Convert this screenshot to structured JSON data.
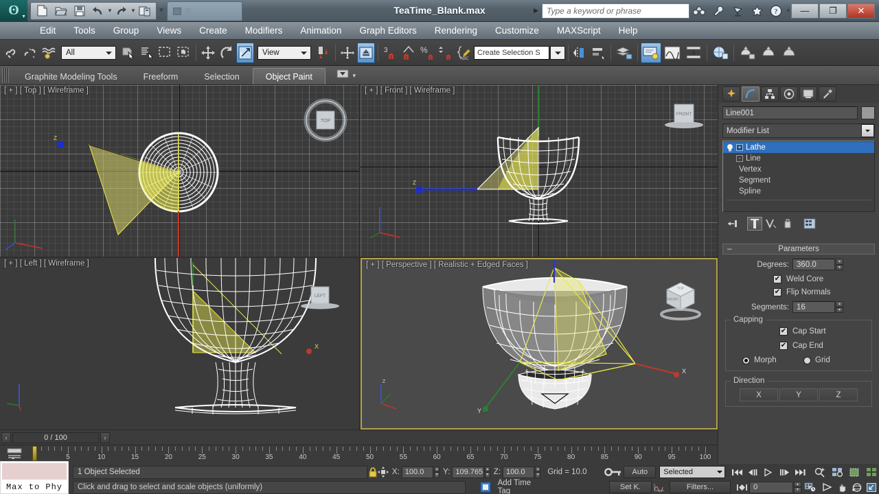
{
  "app": {
    "title": "TeaTime_Blank.max",
    "search_placeholder": "Type a keyword or phrase",
    "logo_glyph": "ʘ"
  },
  "quick_access": [
    {
      "name": "new-file",
      "label": "New"
    },
    {
      "name": "open-file",
      "label": "Open"
    },
    {
      "name": "save-file",
      "label": "Save"
    },
    {
      "name": "undo",
      "label": "Undo"
    },
    {
      "name": "redo",
      "label": "Redo"
    },
    {
      "name": "project-folder",
      "label": "Set Project Folder"
    }
  ],
  "window_buttons": {
    "minimize": "—",
    "maximize": "❐",
    "close": "✕"
  },
  "title_icons": [
    {
      "name": "binoculars-icon",
      "label": "Search"
    },
    {
      "name": "wrench-icon",
      "label": "Tools"
    },
    {
      "name": "satellite-icon",
      "label": "Communication Center"
    },
    {
      "name": "star-icon",
      "label": "Favorites"
    },
    {
      "name": "help-icon",
      "label": "Help"
    }
  ],
  "menu": {
    "items": [
      "Edit",
      "Tools",
      "Group",
      "Views",
      "Create",
      "Modifiers",
      "Animation",
      "Graph Editors",
      "Rendering",
      "Customize",
      "MAXScript",
      "Help"
    ]
  },
  "toolbar": {
    "selection_filter": "All",
    "reference_coord": "View",
    "named_selection_sets": "Create Selection S",
    "snap_count": "3",
    "buttons": [
      {
        "name": "select-and-link-icon",
        "label": "Select and Link"
      },
      {
        "name": "unlink-selection-icon",
        "label": "Unlink Selection"
      },
      {
        "name": "bind-to-space-warp-icon",
        "label": "Bind to Space Warp"
      },
      {
        "name": "select-object-icon",
        "label": "Select Object"
      },
      {
        "name": "select-by-name-icon",
        "label": "Select by Name"
      },
      {
        "name": "rectangular-selection-region-icon",
        "label": "Rectangular Selection Region"
      },
      {
        "name": "window-crossing-icon",
        "label": "Window / Crossing"
      },
      {
        "name": "select-and-move-icon",
        "label": "Select and Move"
      },
      {
        "name": "select-and-rotate-icon",
        "label": "Select and Rotate"
      },
      {
        "name": "select-and-scale-icon",
        "label": "Select and Uniform Scale"
      },
      {
        "name": "use-pivot-point-center-icon",
        "label": "Use Pivot Point Center"
      },
      {
        "name": "select-and-manipulate-icon",
        "label": "Select and Manipulate"
      },
      {
        "name": "snaps-toggle-icon",
        "label": "Snaps Toggle"
      },
      {
        "name": "angle-snap-toggle-icon",
        "label": "Angle Snap Toggle"
      },
      {
        "name": "percent-snap-toggle-icon",
        "label": "Percent Snap Toggle"
      },
      {
        "name": "spinner-snap-toggle-icon",
        "label": "Spinner Snap Toggle"
      },
      {
        "name": "edit-named-selection-sets-icon",
        "label": "Edit Named Selection Sets"
      },
      {
        "name": "mirror-icon",
        "label": "Mirror"
      },
      {
        "name": "align-icon",
        "label": "Align"
      },
      {
        "name": "layer-manager-icon",
        "label": "Layer Explorer"
      },
      {
        "name": "toggle-scene-explorer-icon",
        "label": "Toggle Scene Explorer"
      },
      {
        "name": "curve-editor-icon",
        "label": "Curve Editor"
      },
      {
        "name": "schematic-view-icon",
        "label": "Schematic View"
      },
      {
        "name": "material-editor-icon",
        "label": "Material Editor"
      },
      {
        "name": "render-setup-icon",
        "label": "Render Setup"
      },
      {
        "name": "rendered-frame-window-icon",
        "label": "Rendered Frame Window"
      },
      {
        "name": "render-production-icon",
        "label": "Render Production"
      }
    ]
  },
  "ribbon": {
    "tabs": [
      {
        "label": "Graphite Modeling Tools",
        "active": false
      },
      {
        "label": "Freeform",
        "active": false
      },
      {
        "label": "Selection",
        "active": false
      },
      {
        "label": "Object Paint",
        "active": true
      }
    ],
    "overflow_icon": "polygon-modeling-icon"
  },
  "viewports": [
    {
      "name": "viewport-top",
      "label": "[ + ] [ Top ] [ Wireframe ]",
      "cube_label": "TOP",
      "active": false
    },
    {
      "name": "viewport-front",
      "label": "[ + ] [ Front ] [ Wireframe ]",
      "cube_label": "FRONT",
      "active": false
    },
    {
      "name": "viewport-left",
      "label": "[ + ] [ Left ] [ Wireframe ]",
      "cube_label": "LEFT",
      "active": false
    },
    {
      "name": "viewport-perspective",
      "label": "[ + ] [ Perspective ] [ Realistic + Edged Faces ]",
      "cube_label": "FRONT",
      "active": true
    }
  ],
  "command_panel": {
    "tabs": [
      {
        "name": "create-tab",
        "icon": "create-icon",
        "selected": false
      },
      {
        "name": "modify-tab",
        "icon": "modify-icon",
        "selected": true
      },
      {
        "name": "hierarchy-tab",
        "icon": "hierarchy-icon",
        "selected": false
      },
      {
        "name": "motion-tab",
        "icon": "motion-icon",
        "selected": false
      },
      {
        "name": "display-tab",
        "icon": "display-icon",
        "selected": false
      },
      {
        "name": "utilities-tab",
        "icon": "utilities-icon",
        "selected": false
      }
    ],
    "object_name": "Line001",
    "modifier_list_label": "Modifier List",
    "stack": [
      {
        "label": "Lathe",
        "selected": true,
        "level": 0,
        "expander": "+"
      },
      {
        "label": "Line",
        "selected": false,
        "level": 0,
        "expander": "-"
      },
      {
        "label": "Vertex",
        "selected": false,
        "level": 1,
        "expander": ""
      },
      {
        "label": "Segment",
        "selected": false,
        "level": 1,
        "expander": ""
      },
      {
        "label": "Spline",
        "selected": false,
        "level": 1,
        "expander": ""
      }
    ],
    "stack_buttons": [
      {
        "name": "pin-stack-icon",
        "selected": false
      },
      {
        "name": "show-end-result-icon",
        "selected": true
      },
      {
        "name": "make-unique-icon",
        "selected": false
      },
      {
        "name": "remove-modifier-icon",
        "selected": false
      },
      {
        "name": "configure-modifier-sets-icon",
        "selected": false
      }
    ],
    "rollout": {
      "title": "Parameters",
      "minimize_glyph": "–",
      "degrees_label": "Degrees:",
      "degrees_value": "360.0",
      "weld_core_label": "Weld Core",
      "weld_core_checked": true,
      "flip_normals_label": "Flip Normals",
      "flip_normals_checked": true,
      "segments_label": "Segments:",
      "segments_value": "16",
      "capping": {
        "title": "Capping",
        "cap_start_label": "Cap Start",
        "cap_start_checked": true,
        "cap_end_label": "Cap End",
        "cap_end_checked": true,
        "morph_label": "Morph",
        "grid_label": "Grid",
        "selected_mode": "Morph"
      },
      "direction": {
        "title": "Direction",
        "buttons": [
          "X",
          "Y",
          "Z"
        ]
      }
    }
  },
  "time_slider": {
    "prev_glyph": "‹",
    "next_glyph": "›",
    "value": "0 / 100"
  },
  "track_bar": {
    "labels": [
      "5",
      "10",
      "15",
      "20",
      "25",
      "30",
      "35",
      "40",
      "45",
      "50",
      "55",
      "60",
      "65",
      "70",
      "75",
      "80",
      "85",
      "90",
      "95",
      "100"
    ],
    "range_start": 0,
    "range_end": 100,
    "current_frame": 0
  },
  "status": {
    "color_swatch_label": "Max to Phy",
    "selection": "1 Object Selected",
    "prompt": "Click and drag to select and scale objects (uniformly)",
    "lock_icon": "lock-icon",
    "axis_constraint_icon": "absolute-mode-transform-icon",
    "coords": [
      {
        "axis": "X:",
        "value": "100.0"
      },
      {
        "axis": "Y:",
        "value": "109.765"
      },
      {
        "axis": "Z:",
        "value": "100.0"
      }
    ],
    "grid": "Grid = 10.0",
    "add_time_tag": "Add Time Tag",
    "key_mode_icon": "key-mode-toggle-icon",
    "auto_key": "Auto",
    "set_key": "Set K.",
    "key_filters": "Filters...",
    "key_filter_curve_icon": "key-curve-icon",
    "selection_list": "Selected",
    "frame_value": "0"
  },
  "playback": {
    "buttons": [
      {
        "name": "go-to-start-button",
        "glyph": "⏮"
      },
      {
        "name": "previous-frame-button",
        "glyph": "⏴"
      },
      {
        "name": "play-animation-button",
        "glyph": "▷"
      },
      {
        "name": "next-frame-button",
        "glyph": "⏵"
      },
      {
        "name": "go-to-end-button",
        "glyph": "⏭"
      }
    ],
    "key_mode_button": {
      "name": "key-mode-toggle-button",
      "glyph": "⏭"
    },
    "time_config_icon": "time-configuration-icon"
  },
  "viewport_nav": [
    {
      "name": "zoom-icon"
    },
    {
      "name": "zoom-all-icon"
    },
    {
      "name": "zoom-extents-icon"
    },
    {
      "name": "zoom-extents-all-icon"
    },
    {
      "name": "field-of-view-icon"
    },
    {
      "name": "pan-view-icon"
    },
    {
      "name": "orbit-icon"
    },
    {
      "name": "maximize-viewport-toggle-icon"
    }
  ],
  "colors": {
    "accent_blue": "#2f6fbe",
    "active_viewport_border": "#b4a14a",
    "highlight_orange": "#e0a020",
    "spline_yellow": "#e8e84a",
    "grid_line": "#7a7a7a"
  }
}
